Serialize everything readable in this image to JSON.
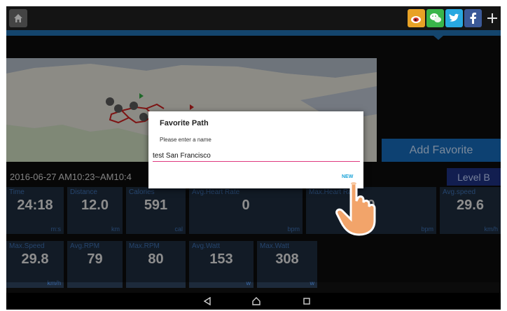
{
  "topbar": {
    "icons": [
      "home-icon",
      "weibo-icon",
      "wechat-icon",
      "twitter-icon",
      "facebook-icon",
      "plus-icon"
    ],
    "colors": {
      "weibo": "#e8a226",
      "wechat": "#39b54a",
      "twitter": "#28a8e0",
      "facebook": "#3b5998"
    }
  },
  "main": {
    "add_favorite": "Add Favorite",
    "level": "Level B",
    "date_range": "2016-06-27 AM10:23~AM10:4",
    "stats_row1": [
      {
        "label": "Time",
        "value": "24:18",
        "unit": "m:s"
      },
      {
        "label": "Distance",
        "value": "12.0",
        "unit": "km"
      },
      {
        "label": "Calories",
        "value": "591",
        "unit": "cal"
      },
      {
        "label": "Avg.Heart Rate",
        "value": "0",
        "unit": "bpm"
      },
      {
        "label": "Max.Heart Rate",
        "value": "0",
        "unit": "bpm"
      },
      {
        "label": "Avg.speed",
        "value": "29.6",
        "unit": "km/h"
      }
    ],
    "stats_row2": [
      {
        "label": "Max.Speed",
        "value": "29.8",
        "unit": "km/h"
      },
      {
        "label": "Avg.RPM",
        "value": "79",
        "unit": ""
      },
      {
        "label": "Max.RPM",
        "value": "80",
        "unit": ""
      },
      {
        "label": "Avg.Watt",
        "value": "153",
        "unit": "w"
      },
      {
        "label": "Max.Watt",
        "value": "308",
        "unit": "w"
      }
    ]
  },
  "dialog": {
    "title": "Favorite Path",
    "prompt": "Please enter a name",
    "input_value": "test San Francisco",
    "new_button": "NEW"
  },
  "navbar": {
    "icons": [
      "back-icon",
      "home-circle-icon",
      "recents-icon"
    ]
  },
  "accent_colors": {
    "primary": "#1f6aa8",
    "input_underline": "#e0397f",
    "dialog_button": "#1ba3d8"
  }
}
